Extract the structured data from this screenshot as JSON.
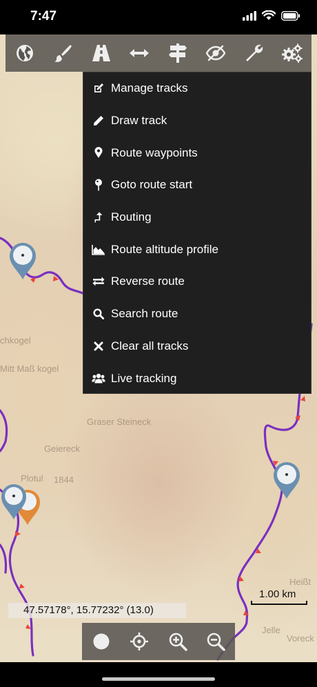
{
  "status_bar": {
    "time": "7:47",
    "icons": [
      "signal-icon",
      "wifi-icon",
      "battery-icon"
    ]
  },
  "toolbar": {
    "items": [
      {
        "name": "globe-icon"
      },
      {
        "name": "paintbrush-icon"
      },
      {
        "name": "road-icon"
      },
      {
        "name": "arrows-horizontal-icon"
      },
      {
        "name": "signpost-icon"
      },
      {
        "name": "eye-slash-icon"
      },
      {
        "name": "wrench-icon"
      },
      {
        "name": "gears-icon"
      }
    ]
  },
  "menu": {
    "items": [
      {
        "label": "Manage tracks",
        "icon": "edit-icon"
      },
      {
        "label": "Draw track",
        "icon": "pencil-icon"
      },
      {
        "label": "Route waypoints",
        "icon": "map-pin-icon"
      },
      {
        "label": "Goto route start",
        "icon": "pushpin-icon"
      },
      {
        "label": "Routing",
        "icon": "turn-up-icon"
      },
      {
        "label": "Route altitude profile",
        "icon": "area-chart-icon"
      },
      {
        "label": "Reverse route",
        "icon": "exchange-icon"
      },
      {
        "label": "Search route",
        "icon": "search-icon"
      },
      {
        "label": "Clear all tracks",
        "icon": "close-icon"
      },
      {
        "label": "Live tracking",
        "icon": "users-icon"
      }
    ]
  },
  "map": {
    "place_labels": [
      "Graser Steineck",
      "Geiereck",
      "Plotul",
      "1844",
      "Heißt",
      "Jelle",
      "Voreck",
      "chkogel",
      "Mitt Maß kogel"
    ],
    "colors": {
      "track": "#7a2fc0",
      "arrow": "#e8453a",
      "marker": "#6a8fb0"
    }
  },
  "coordinates": {
    "text": "47.57178°, 15.77232° (13.0)"
  },
  "scale": {
    "label": "1.00 km"
  },
  "bottom_controls": {
    "items": [
      {
        "name": "record-icon"
      },
      {
        "name": "locate-crosshair-icon"
      },
      {
        "name": "zoom-in-icon"
      },
      {
        "name": "zoom-out-icon"
      }
    ]
  }
}
